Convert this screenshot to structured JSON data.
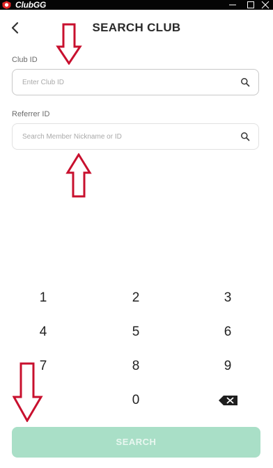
{
  "window": {
    "app_name": "ClubGG",
    "controls": [
      "minimize-icon",
      "maximize-icon",
      "close-icon"
    ]
  },
  "header": {
    "title": "SEARCH CLUB",
    "back_icon": "chevron-left-icon"
  },
  "form": {
    "club_id": {
      "label": "Club ID",
      "value": "",
      "placeholder": "Enter Club ID",
      "icon": "search-icon"
    },
    "referrer_id": {
      "label": "Referrer ID",
      "value": "",
      "placeholder": "Search Member Nickname or ID",
      "icon": "search-icon"
    }
  },
  "keypad": {
    "keys": [
      "1",
      "2",
      "3",
      "4",
      "5",
      "6",
      "7",
      "8",
      "9",
      "0"
    ],
    "backspace_icon": "backspace-icon"
  },
  "actions": {
    "search_label": "SEARCH",
    "search_enabled": false
  },
  "annotations": {
    "arrow_color": "#c8102e",
    "arrows": [
      "arrow-down-icon",
      "arrow-up-icon",
      "arrow-down-icon"
    ]
  },
  "colors": {
    "accent": "#a9dfc7",
    "titlebar": "#050505"
  }
}
